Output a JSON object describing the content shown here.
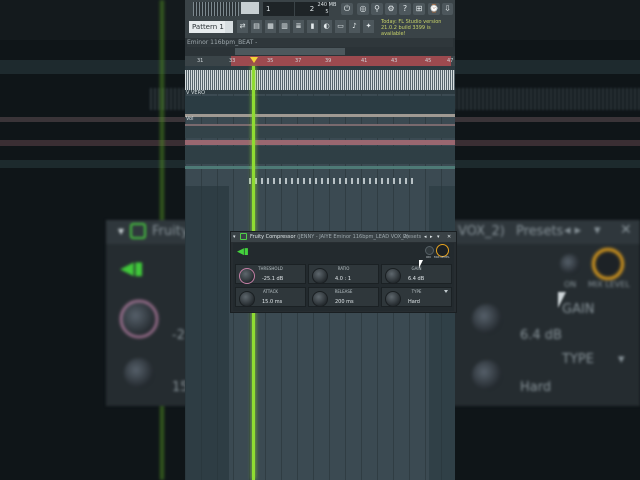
{
  "toolbar": {
    "pattern_label": "Pattern 1",
    "counter_1": "1",
    "counter_2": "2",
    "memory": "240 MB",
    "cpu": "5",
    "icons": [
      "metronome-icon",
      "record-icon",
      "wait-icon",
      "mixer-icon",
      "help-icon",
      "tempo-icon",
      "browser-icon",
      "download-icon"
    ],
    "news_line1": "Today: FL Studio version",
    "news_line2": "21.0.2 build 3399 is available!"
  },
  "playlist": {
    "title": "Eminor 116bpm_BEAT -",
    "ruler_ticks": [
      "31",
      "33",
      "35",
      "37",
      "39",
      "41",
      "43",
      "45",
      "47"
    ],
    "track_labels": [
      "V  VERO",
      "Vol"
    ]
  },
  "plugin": {
    "title": "Fruity Compressor",
    "subtitle": "(JENNY - JAIYE Eminor 116bpm_LEAD VOX_2)",
    "presets": "Presets",
    "on_label": "ON",
    "mix_label": "MIX LEVEL",
    "params": [
      {
        "label": "THRESHOLD",
        "value": "-25.1 dB"
      },
      {
        "label": "RATIO",
        "value": "4.0 : 1"
      },
      {
        "label": "GAIN",
        "value": "6.4 dB"
      },
      {
        "label": "ATTACK",
        "value": "15.0 ms"
      },
      {
        "label": "RELEASE",
        "value": "200 ms"
      },
      {
        "label": "TYPE",
        "value": "Hard"
      }
    ]
  },
  "background": {
    "plugin_title": "Fruity",
    "plugin_sub": "VOX_2)",
    "presets": "Presets",
    "on_label": "ON",
    "mix_label": "MIX LEVEL",
    "gain_label": "GAIN",
    "gain_value": "6.4 dB",
    "type_label": "TYPE",
    "type_value": "Hard",
    "threshold_partial": "-2",
    "attack_partial": "15"
  },
  "colors": {
    "accent_green": "#8fdc32",
    "loop_red": "#9c4a4f",
    "mix_knob": "#e8a31e"
  }
}
